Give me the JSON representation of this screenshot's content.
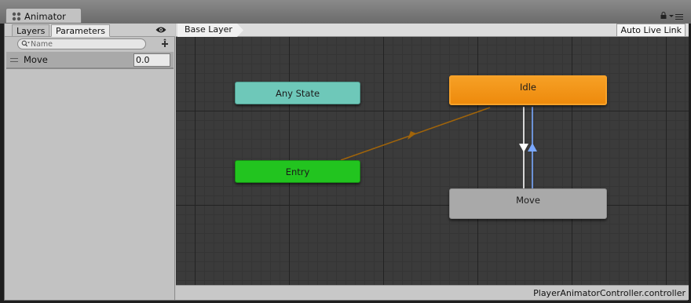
{
  "window": {
    "tab_title": "Animator"
  },
  "left_panel": {
    "tabs": [
      {
        "label": "Layers"
      },
      {
        "label": "Parameters"
      }
    ],
    "search": {
      "placeholder": "Name"
    },
    "parameters": [
      {
        "name": "Move",
        "value": "0.0"
      }
    ]
  },
  "graph": {
    "breadcrumb": "Base Layer",
    "live_link_label": "Auto Live Link",
    "states": {
      "any_state": "Any State",
      "entry": "Entry",
      "idle": "Idle",
      "move": "Move"
    },
    "colors": {
      "any_state": "#6ec8b9",
      "entry": "#22c41f",
      "idle_default": "#f09410",
      "move": "#a9a9a9",
      "entry_transition": "#a0640a",
      "selected_transition": "#7aa8ff"
    }
  },
  "status_bar": {
    "controller_file": "PlayerAnimatorController.controller"
  },
  "icons": [
    "animator-icon",
    "lock-icon",
    "menu-icon",
    "eye-icon",
    "search-icon",
    "plus-icon",
    "drag-handle-icon"
  ]
}
